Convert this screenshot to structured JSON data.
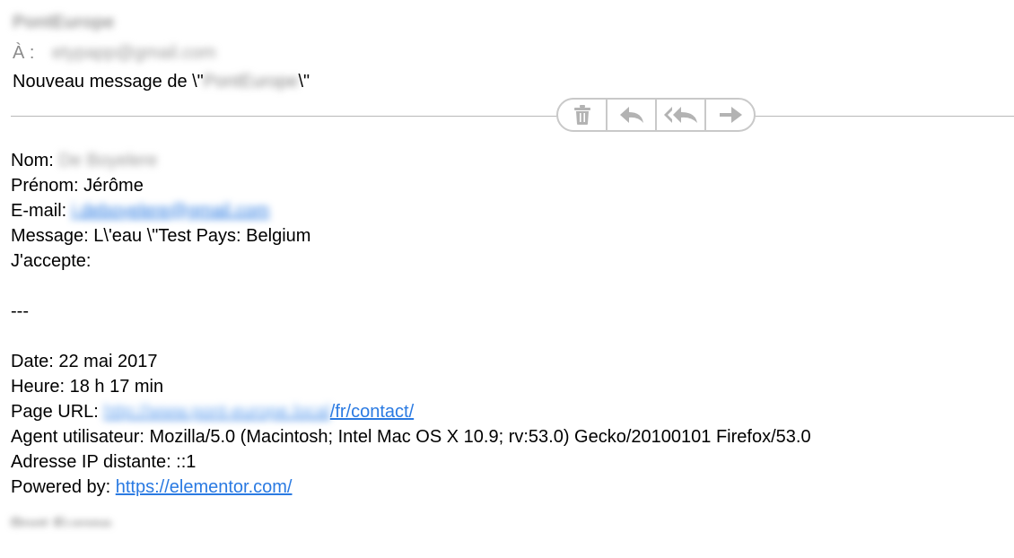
{
  "header": {
    "sender_name": "PontEurope",
    "to_label": "À :",
    "to_address": "etypapp@gmail.com",
    "subject_prefix": "Nouveau message de \\\"",
    "subject_name": "PontEurope",
    "subject_suffix": "\\\""
  },
  "toolbar": {
    "icons": [
      "trash-icon",
      "reply-icon",
      "reply-all-icon",
      "forward-icon"
    ],
    "icon_color": "#b3b3b3"
  },
  "body": {
    "nom_label": "Nom:",
    "nom_value": "De Boyelere",
    "prenom_line": "Prénom: Jérôme",
    "email_label": "E-mail:",
    "email_value": "j.deboyelere@gmail.com",
    "message_line": "Message: L\\'eau \\\"Test Pays: Belgium",
    "accept_line": "J'accepte:",
    "separator": "---",
    "date_line": "Date: 22 mai 2017",
    "heure_line": "Heure: 18 h 17 min",
    "page_url_label": "Page URL:",
    "page_url_domain": "http://www.pont-europe.local",
    "page_url_path": "/fr/contact/",
    "agent_line": "Agent utilisateur: Mozilla/5.0 (Macintosh; Intel Mac OS X 10.9; rv:53.0) Gecko/20100101 Firefox/53.0",
    "ip_line": "Adresse IP distante: ::1",
    "powered_label": "Powered by:",
    "powered_link": "https://elementor.com/",
    "cutoff_text": "Pont-Europe"
  },
  "colors": {
    "link": "#2a7ae2",
    "toolbar_border": "#c9c9c9",
    "divider": "#b8b8b8"
  }
}
